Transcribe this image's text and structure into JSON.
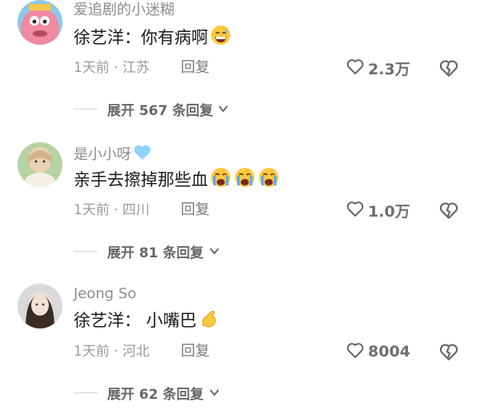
{
  "comments": [
    {
      "username": "爱追剧的小迷糊",
      "text": "徐艺洋：你有病啊",
      "time_location": "1天前 · 江苏",
      "reply_label": "回复",
      "likes": "2.3万",
      "replies": "展开 567 条回复",
      "text_emoji": [
        "grinning-sweat-emoji"
      ]
    },
    {
      "username": "是小小呀",
      "username_emoji": "light-blue-heart-emoji",
      "text": "亲手去擦掉那些血",
      "time_location": "1天前 · 四川",
      "reply_label": "回复",
      "likes": "1.0万",
      "replies": "展开 81 条回复",
      "text_emoji": [
        "crying-face-emoji",
        "crying-face-emoji",
        "crying-face-emoji"
      ]
    },
    {
      "username": "Jeong So",
      "text": "徐艺洋：  小嘴巴",
      "time_location": "1天前 · 河北",
      "reply_label": "回复",
      "likes": "8004",
      "replies": "展开 62 条回复",
      "text_emoji": [
        "pinching-hand-emoji"
      ]
    }
  ],
  "colors": {
    "username": "#8c8c8c",
    "text": "#1a1a1a",
    "meta": "#9a9a9a",
    "emoji_face": "#ffc83d"
  }
}
